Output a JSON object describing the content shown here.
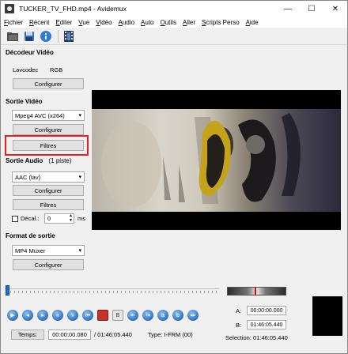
{
  "window": {
    "title": "TUCKER_TV_FHD.mp4 - Avidemux",
    "minimize": "—",
    "maximize": "☐",
    "close": "✕"
  },
  "menu": [
    "Fichier",
    "Récent",
    "Editer",
    "Vue",
    "Vidéo",
    "Audio",
    "Auto",
    "Outils",
    "Aller",
    "Scripts Perso",
    "Aide"
  ],
  "toolbar": {
    "icons": [
      "open-folder-icon",
      "save-icon",
      "info-icon",
      "film-icon"
    ]
  },
  "decoder": {
    "title": "Décodeur Vidéo",
    "codec": "Lavcodec",
    "format": "RGB",
    "configure": "Configurer"
  },
  "video_out": {
    "title": "Sortie Vidéo",
    "codec": "Mpeg4 AVC (x264)",
    "configure": "Configurer",
    "filters": "Filtres"
  },
  "audio_out": {
    "title": "Sortie Audio",
    "tracks": "(1 piste)",
    "codec": "AAC (lav)",
    "configure": "Configurer",
    "filters": "Filtres",
    "shift_label": "Décal.:",
    "shift_value": "0",
    "shift_unit": "ms"
  },
  "output_format": {
    "title": "Format de sortie",
    "muxer": "MP4 Muxer",
    "configure": "Configurer"
  },
  "timeline": {
    "time_button": "Temps:",
    "current_time": "00:00:00.080",
    "total_time": "/ 01:46:05.440",
    "frame_type": "Type:  I-FRM (00)",
    "position_fraction": 0.0
  },
  "selection": {
    "a_label": "A:",
    "a_value": "00:00:00.000",
    "b_label": "B:",
    "b_value": "01:46:05.440",
    "summary": "Selection: 01:46:05.440"
  },
  "colors": {
    "highlight": "#e0202a",
    "slider": "#1f6fd0"
  }
}
